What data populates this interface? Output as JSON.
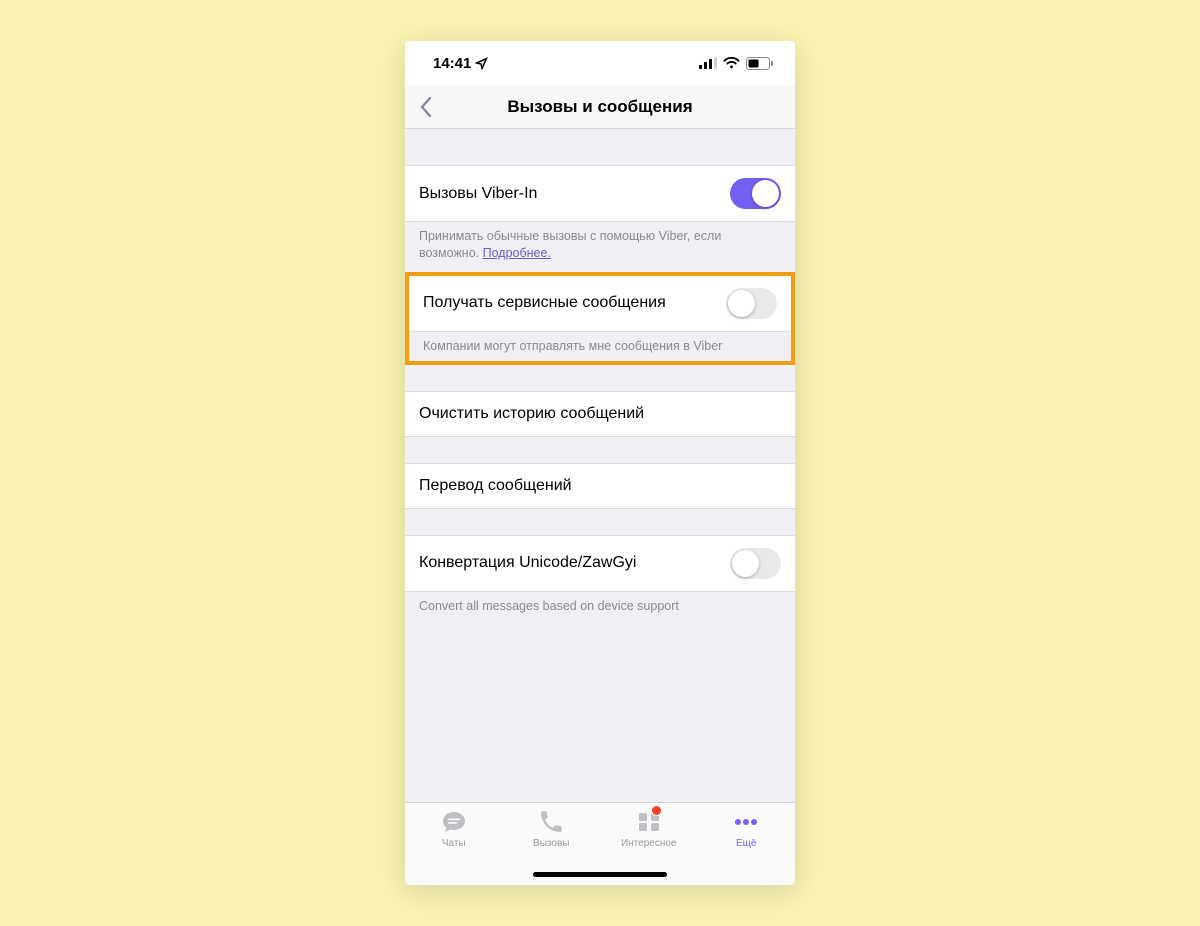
{
  "statusbar": {
    "time": "14:41"
  },
  "nav": {
    "title": "Вызовы и сообщения"
  },
  "rows": {
    "viber_in": {
      "label": "Вызовы Viber-In",
      "on": true,
      "footnote_text": "Принимать обычные вызовы с помощью Viber, если возможно. ",
      "footnote_link": "Подробнее."
    },
    "service_msgs": {
      "label": "Получать сервисные сообщения",
      "on": false,
      "footnote": "Компании могут отправлять мне сообщения в Viber"
    },
    "clear_history": {
      "label": "Очистить историю сообщений"
    },
    "translate": {
      "label": "Перевод сообщений"
    },
    "unicode": {
      "label": "Конвертация Unicode/ZawGyi",
      "on": false,
      "footnote": "Convert all messages based on device support"
    }
  },
  "tabs": {
    "chats": "Чаты",
    "calls": "Вызовы",
    "explore": "Интересное",
    "more": "Ещё"
  }
}
